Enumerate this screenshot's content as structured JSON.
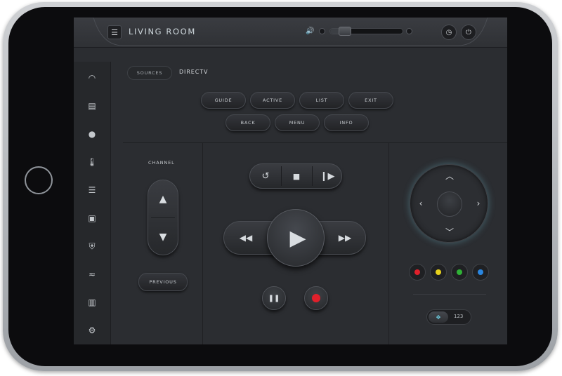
{
  "header": {
    "title": "LIVING ROOM",
    "menu_icon": "menu-icon",
    "volume_icon": "speaker-icon",
    "volume_level": 0.12,
    "timer_icon": "clock-icon",
    "power_icon": "power-icon"
  },
  "sidebar": {
    "items": [
      {
        "icon": "dashboard-icon",
        "glyph": "◠"
      },
      {
        "icon": "media-icon",
        "glyph": "▤"
      },
      {
        "icon": "light-bulb-icon",
        "glyph": "●"
      },
      {
        "icon": "thermometer-icon",
        "glyph": "🌡"
      },
      {
        "icon": "list-icon",
        "glyph": "☰"
      },
      {
        "icon": "garage-icon",
        "glyph": "▣"
      },
      {
        "icon": "security-shield-icon",
        "glyph": "⛨"
      },
      {
        "icon": "pool-icon",
        "glyph": "≈"
      },
      {
        "icon": "map-icon",
        "glyph": "▥"
      },
      {
        "icon": "settings-gear-icon",
        "glyph": "⚙"
      }
    ]
  },
  "sources": {
    "button_label": "SOURCES",
    "current": "DIRECTV"
  },
  "menu_buttons": {
    "row1": [
      "GUIDE",
      "ACTIVE",
      "LIST",
      "EXIT"
    ],
    "row2": [
      "BACK",
      "MENU",
      "INFO"
    ]
  },
  "channel": {
    "label": "CHANNEL",
    "previous_label": "PREVIOUS"
  },
  "transport": {
    "replay_glyph": "↺",
    "stop_glyph": "■",
    "skip_glyph": "⏵",
    "rewind_glyph": "◀◀",
    "play_glyph": "▶",
    "ffwd_glyph": "▶▶",
    "pause_glyph": "❚❚"
  },
  "colors": {
    "accent_cyan": "#6fd2e6",
    "record_red": "#e0202b",
    "btn_red": "#e0202b",
    "btn_yellow": "#e8d21c",
    "btn_green": "#2fb236",
    "btn_blue": "#2a86e0"
  },
  "keypad_toggle": {
    "label": "123"
  }
}
